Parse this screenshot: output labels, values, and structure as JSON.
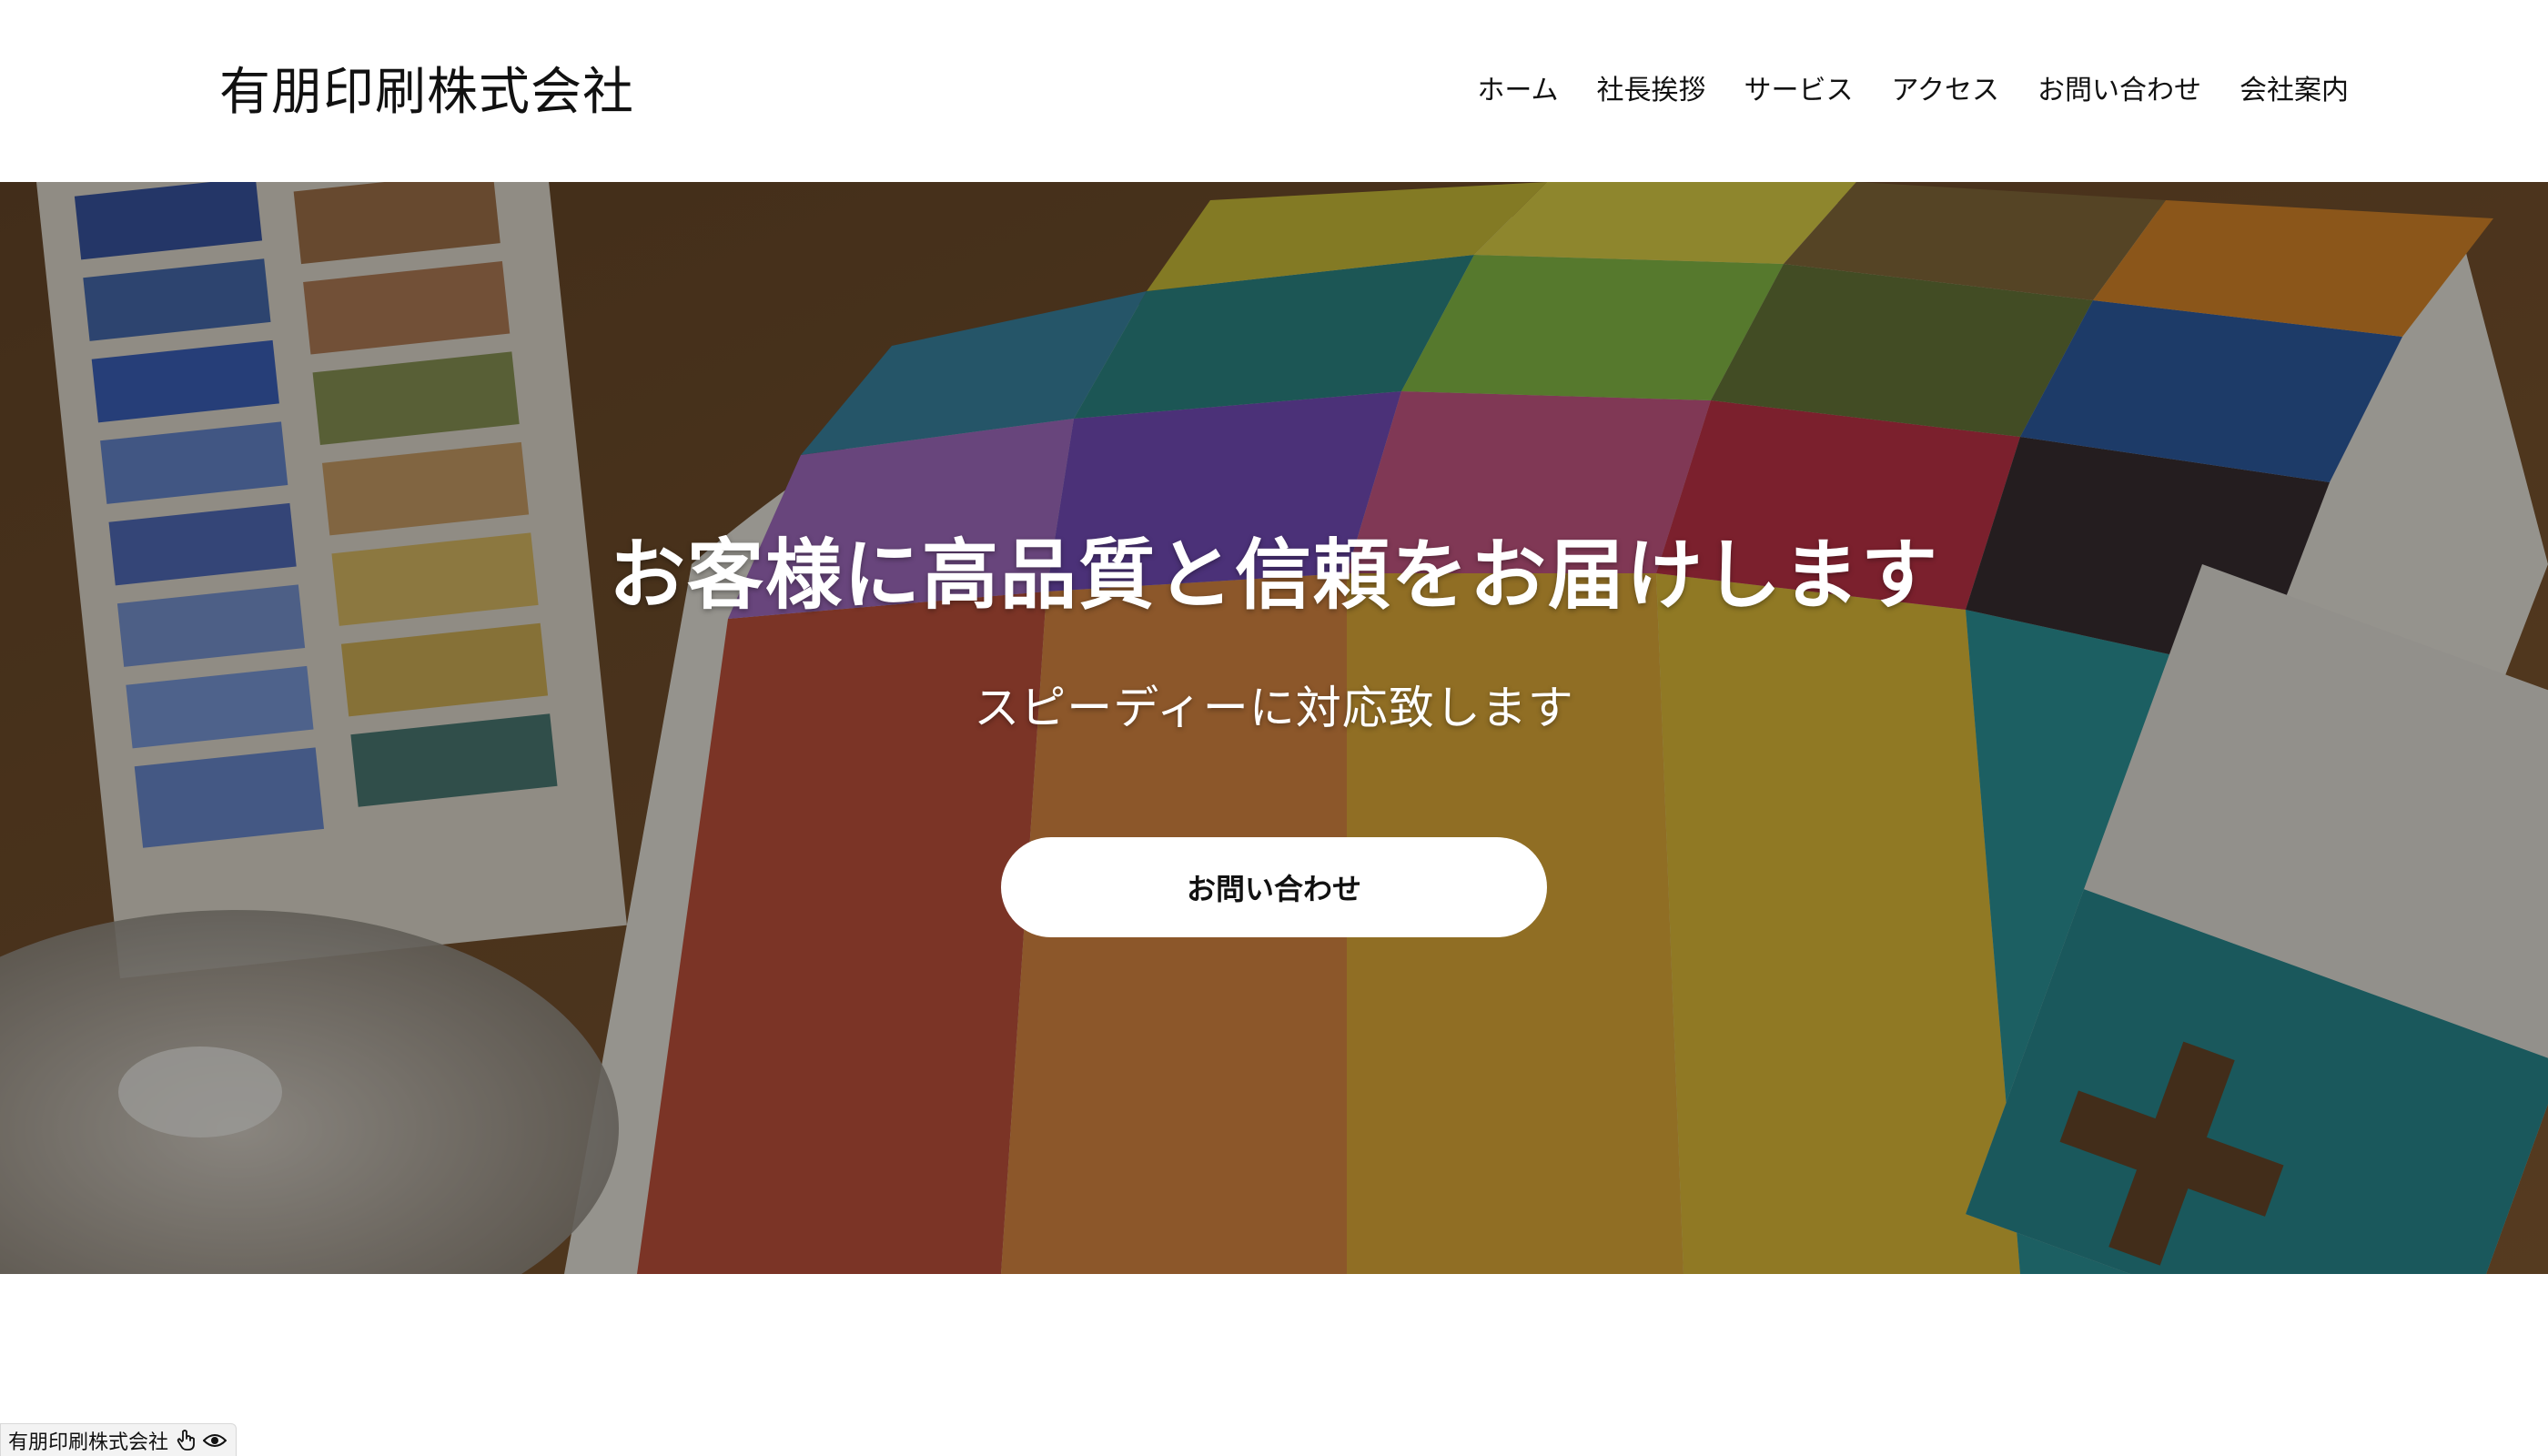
{
  "header": {
    "site_title": "有朋印刷株式会社",
    "nav": [
      {
        "label": "ホーム"
      },
      {
        "label": "社長挨拶"
      },
      {
        "label": "サービス"
      },
      {
        "label": "アクセス"
      },
      {
        "label": "お問い合わせ"
      },
      {
        "label": "会社案内"
      }
    ]
  },
  "hero": {
    "title": "お客様に高品質と信頼をお届けします",
    "subtitle": "スピーディーに対応致します",
    "cta_label": "お問い合わせ"
  },
  "footer_badge": {
    "label": "有朋印刷株式会社",
    "icons": [
      "hand-pointer-icon",
      "eye-icon"
    ]
  }
}
